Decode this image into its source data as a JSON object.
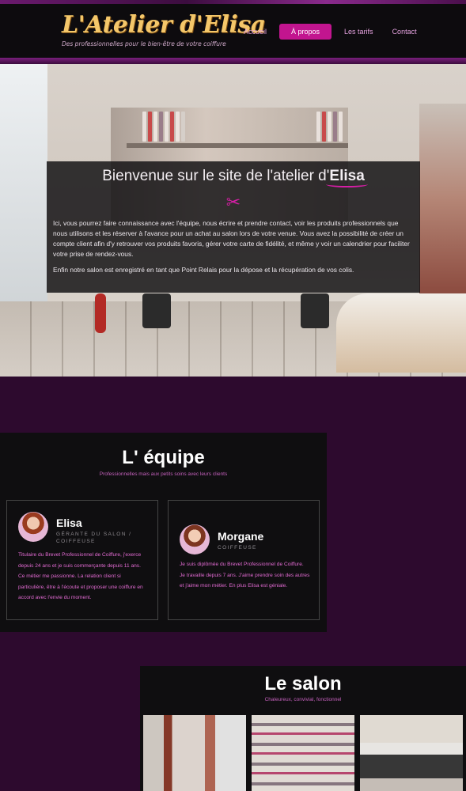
{
  "header": {
    "logo_title": "L'Atelier d'Elisa",
    "logo_subtitle": "Des professionnelles pour le bien-être de votre coiffure",
    "nav": [
      {
        "label": "Accueil",
        "active": false
      },
      {
        "label": "À propos",
        "active": true
      },
      {
        "label": "Les tarifs",
        "active": false
      },
      {
        "label": "Contact",
        "active": false
      }
    ]
  },
  "hero": {
    "title_prefix": "Bienvenue sur le site de l'atelier d'",
    "title_name": "Elisa",
    "icon": "scissors-icon",
    "paragraph_1": "Ici, vous pourrez faire connaissance avec l'équipe, nous écrire et prendre contact, voir les produits professionnels que nous utilisons et les réserver à l'avance pour un achat au salon lors de votre venue. Vous avez la possibilité de créer un compte client afin d'y retrouver vos produits favoris, gérer votre carte de fidélité, et même y voir un calendrier pour faciliter votre prise de rendez-vous.",
    "paragraph_2": "Enfin notre salon est enregistré en tant que Point Relais pour la dépose et la récupération de vos colis."
  },
  "team": {
    "title": "L' équipe",
    "tagline": "Professionnelles mais aux petits soins avec leurs clients",
    "members": [
      {
        "name": "Elisa",
        "role": "GÉRANTE DU SALON / COIFFEUSE",
        "bio": "Titulaire du Brevet Professionnel de Coiffure, j'exerce depuis 24 ans et je suis commerçante depuis 11 ans. Ce métier me passionne. La relation client si particulière, être à l'écoute et proposer une coiffure en accord avec l'envie du moment."
      },
      {
        "name": "Morgane",
        "role": "COIFFEUSE",
        "bio": "Je suis diplômée du Brevet Professionnel de Coiffure. Je travaille depuis 7 ans. J'aime prendre soin des autres et j'aime mon métier. En plus Elisa est géniale."
      }
    ]
  },
  "salon": {
    "title": "Le salon",
    "tagline": "Chaleureux, convivial, fonctionnel"
  },
  "colors": {
    "accent": "#c2158f",
    "background": "#2d0a2e",
    "panel": "#0f0e10",
    "logo_gold": "#f4c76a",
    "pink_text": "#e36bd3"
  }
}
